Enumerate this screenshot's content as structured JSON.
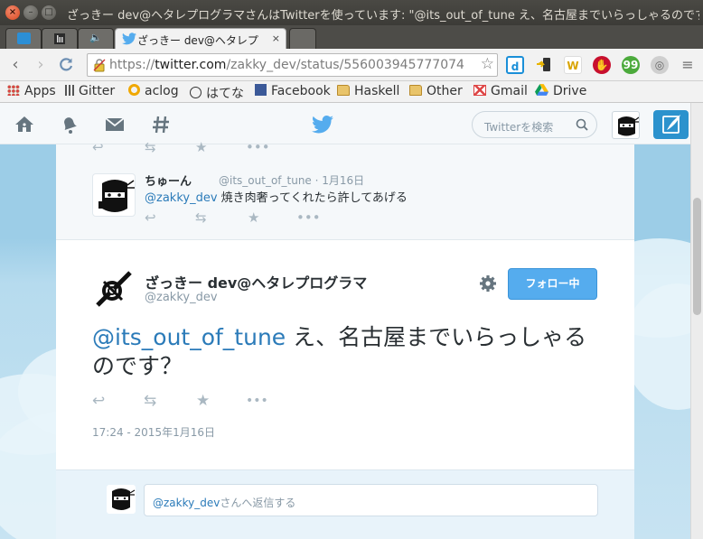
{
  "window": {
    "title": "ざっきー dev@ヘタレプログラマさんはTwitterを使っています: \"@its_out_of_tune え、名古屋までいらっしゃるのです？\""
  },
  "tabs": [
    {
      "label": "",
      "icon": "twitter-icon"
    },
    {
      "label": "",
      "icon": "gitter-icon"
    },
    {
      "label": "",
      "icon": "speaker-icon"
    },
    {
      "label": "ざっきー dev@ヘタレプ",
      "icon": "twitter-icon",
      "active": true
    },
    {
      "label": "",
      "icon": "new-tab"
    }
  ],
  "omnibox": {
    "scheme": "https://",
    "host": "twitter.com",
    "path": "/zakky_dev/status/556003945777074"
  },
  "bookmarks": [
    {
      "label": "Apps",
      "icon": "apps-grid-icon"
    },
    {
      "label": "Gitter",
      "icon": "gitter-icon"
    },
    {
      "label": "aclog",
      "icon": "aclog-icon"
    },
    {
      "label": "はてな",
      "icon": "hatena-icon"
    },
    {
      "label": "Facebook",
      "icon": "facebook-icon"
    },
    {
      "label": "Haskell",
      "icon": "folder-icon"
    },
    {
      "label": "Other",
      "icon": "folder-icon"
    },
    {
      "label": "Gmail",
      "icon": "gmail-icon"
    },
    {
      "label": "Drive",
      "icon": "drive-icon"
    }
  ],
  "twitter_nav": {
    "search_placeholder": "Twitterを検索"
  },
  "reply_tweet": {
    "name": "ちゅーん",
    "meta": "@its_out_of_tune · 1月16日",
    "mention": "@zakky_dev",
    "text": " 焼き肉奢ってくれたら許してあげる"
  },
  "main_tweet": {
    "name": "ざっきー dev@ヘタレプログラマ",
    "handle": "@zakky_dev",
    "follow_label": "フォロー中",
    "mention": "@its_out_of_tune",
    "text": " え、名古屋までいらっしゃるのです？",
    "timestamp": "17:24 - 2015年1月16日"
  },
  "reply_box": {
    "mention": "@zakky_dev",
    "placeholder_rest": "さんへ返信する"
  },
  "colors": {
    "twitter_blue": "#55acee",
    "link_blue": "#2b7bb9",
    "background_sky": "#9ccde7"
  }
}
